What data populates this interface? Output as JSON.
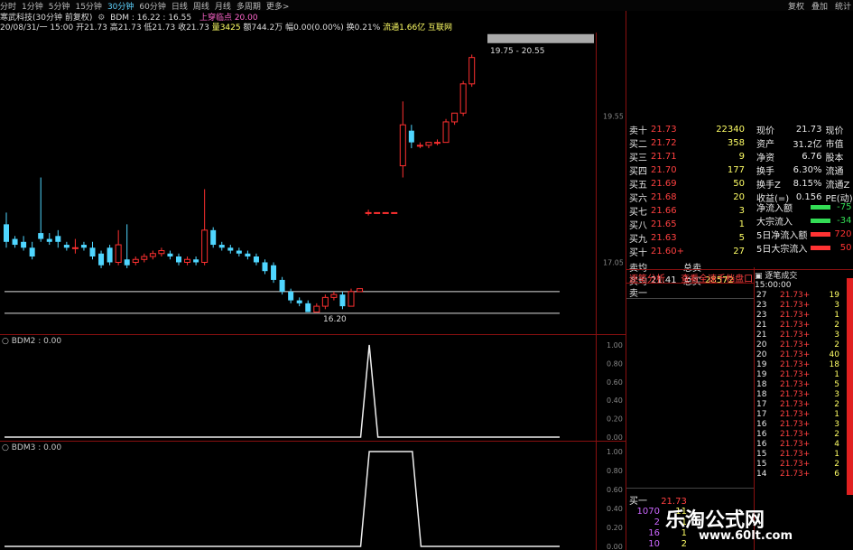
{
  "toolbar": {
    "periods": [
      "分时",
      "1分钟",
      "5分钟",
      "15分钟",
      "30分钟",
      "60分钟",
      "日线",
      "周线",
      "月线",
      "多周期",
      "更多>"
    ],
    "selected": "30分钟",
    "right_buttons": [
      "复权",
      "叠加",
      "统计"
    ]
  },
  "title": {
    "stock": "寒武科技(30分钟 前复权)",
    "indicator": "BDM : 16.22 : 16.55",
    "signal": "上穿临点 20.00"
  },
  "ohlc_line": {
    "date": "20/08/31/一 15:00",
    "open": "开21.73",
    "high": "高21.73",
    "low": "低21.73",
    "close": "收21.73",
    "vol": "量3425",
    "amount": "额744.2万",
    "change": "幅0.00(0.00%)",
    "turnover": "换0.21%",
    "float": "流通1.66亿",
    "link": "互联网"
  },
  "main_chart": {
    "price_axis": [
      "19.55",
      "17.05"
    ],
    "box_label": "19.75 - 20.55",
    "low_label": "16.20",
    "candles": [
      {
        "o": 17.7,
        "c": 17.4,
        "h": 17.9,
        "l": 17.3
      },
      {
        "o": 17.45,
        "c": 17.35,
        "h": 17.5,
        "l": 17.3
      },
      {
        "o": 17.4,
        "c": 17.3,
        "h": 17.5,
        "l": 17.25
      },
      {
        "o": 17.3,
        "c": 17.15,
        "h": 17.4,
        "l": 17.1
      },
      {
        "o": 17.55,
        "c": 17.45,
        "h": 18.5,
        "l": 17.4
      },
      {
        "o": 17.45,
        "c": 17.4,
        "h": 17.55,
        "l": 17.35
      },
      {
        "o": 17.5,
        "c": 17.4,
        "h": 17.6,
        "l": 17.3
      },
      {
        "o": 17.35,
        "c": 17.3,
        "h": 17.4,
        "l": 17.25
      },
      {
        "o": 17.3,
        "c": 17.3,
        "h": 17.45,
        "l": 17.2
      },
      {
        "o": 17.35,
        "c": 17.3,
        "h": 17.4,
        "l": 17.25
      },
      {
        "o": 17.3,
        "c": 17.15,
        "h": 17.4,
        "l": 17.1
      },
      {
        "o": 17.2,
        "c": 17.0,
        "h": 17.25,
        "l": 16.95
      },
      {
        "o": 17.3,
        "c": 17.05,
        "h": 17.35,
        "l": 17.0
      },
      {
        "o": 17.05,
        "c": 17.35,
        "h": 17.6,
        "l": 17.0
      },
      {
        "o": 17.1,
        "c": 17.0,
        "h": 17.7,
        "l": 16.95
      },
      {
        "o": 17.05,
        "c": 17.1,
        "h": 17.15,
        "l": 17.0
      },
      {
        "o": 17.1,
        "c": 17.15,
        "h": 17.2,
        "l": 17.05
      },
      {
        "o": 17.15,
        "c": 17.2,
        "h": 17.25,
        "l": 17.1
      },
      {
        "o": 17.2,
        "c": 17.25,
        "h": 17.3,
        "l": 17.15
      },
      {
        "o": 17.2,
        "c": 17.15,
        "h": 17.25,
        "l": 17.1
      },
      {
        "o": 17.15,
        "c": 17.05,
        "h": 17.2,
        "l": 17.0
      },
      {
        "o": 17.05,
        "c": 17.1,
        "h": 17.15,
        "l": 17.0
      },
      {
        "o": 17.1,
        "c": 17.05,
        "h": 17.15,
        "l": 17.0
      },
      {
        "o": 17.05,
        "c": 17.6,
        "h": 18.3,
        "l": 17.0
      },
      {
        "o": 17.6,
        "c": 17.35,
        "h": 17.65,
        "l": 17.3
      },
      {
        "o": 17.35,
        "c": 17.3,
        "h": 17.4,
        "l": 17.25
      },
      {
        "o": 17.3,
        "c": 17.25,
        "h": 17.35,
        "l": 17.2
      },
      {
        "o": 17.25,
        "c": 17.2,
        "h": 17.3,
        "l": 17.15
      },
      {
        "o": 17.2,
        "c": 17.15,
        "h": 17.25,
        "l": 17.1
      },
      {
        "o": 17.15,
        "c": 17.05,
        "h": 17.2,
        "l": 17.0
      },
      {
        "o": 17.05,
        "c": 16.9,
        "h": 17.1,
        "l": 16.85
      },
      {
        "o": 17.0,
        "c": 16.75,
        "h": 17.05,
        "l": 16.7
      },
      {
        "o": 16.75,
        "c": 16.55,
        "h": 16.8,
        "l": 16.5
      },
      {
        "o": 16.55,
        "c": 16.4,
        "h": 16.6,
        "l": 16.35
      },
      {
        "o": 16.4,
        "c": 16.35,
        "h": 16.45,
        "l": 16.3
      },
      {
        "o": 16.35,
        "c": 16.2,
        "h": 16.4,
        "l": 16.2
      },
      {
        "o": 16.2,
        "c": 16.3,
        "h": 16.35,
        "l": 16.2
      },
      {
        "o": 16.3,
        "c": 16.45,
        "h": 16.5,
        "l": 16.25
      },
      {
        "o": 16.45,
        "c": 16.5,
        "h": 16.55,
        "l": 16.4
      },
      {
        "o": 16.5,
        "c": 16.3,
        "h": 16.55,
        "l": 16.25
      },
      {
        "o": 16.3,
        "c": 16.55,
        "h": 16.6,
        "l": 16.3
      },
      {
        "o": 16.55,
        "c": 16.6,
        "h": 16.6,
        "l": 16.55
      },
      {
        "o": 17.9,
        "c": 17.9,
        "h": 17.95,
        "l": 17.85
      },
      {
        "o": 17.9,
        "c": 17.9,
        "h": 17.9,
        "l": 17.9
      },
      {
        "o": 17.9,
        "c": 17.9,
        "h": 17.9,
        "l": 17.9
      },
      {
        "o": 17.9,
        "c": 17.9,
        "h": 17.9,
        "l": 17.9
      },
      {
        "o": 18.7,
        "c": 19.4,
        "h": 19.8,
        "l": 18.5
      },
      {
        "o": 19.3,
        "c": 19.1,
        "h": 19.4,
        "l": 19.0
      },
      {
        "o": 19.05,
        "c": 19.05,
        "h": 19.1,
        "l": 19.0
      },
      {
        "o": 19.05,
        "c": 19.1,
        "h": 19.1,
        "l": 19.0
      },
      {
        "o": 19.1,
        "c": 19.1,
        "h": 19.15,
        "l": 19.05
      },
      {
        "o": 19.1,
        "c": 19.45,
        "h": 19.5,
        "l": 19.1
      },
      {
        "o": 19.45,
        "c": 19.6,
        "h": 19.6,
        "l": 19.4
      },
      {
        "o": 19.6,
        "c": 20.1,
        "h": 20.15,
        "l": 19.55
      },
      {
        "o": 20.1,
        "c": 20.55,
        "h": 20.6,
        "l": 20.05
      }
    ]
  },
  "indicator1": {
    "label": "BDM2 : 0.00",
    "axis": [
      "1.00",
      "0.80",
      "0.60",
      "0.40",
      "0.20",
      "0.00"
    ],
    "pulse": [
      0,
      0,
      0,
      0,
      0,
      0,
      0,
      0,
      0,
      0,
      0,
      0,
      0,
      0,
      0,
      0,
      0,
      0,
      0,
      0,
      0,
      0,
      0,
      0,
      0,
      0,
      0,
      0,
      0,
      0,
      0,
      0,
      0,
      0,
      0,
      0,
      0,
      0,
      0,
      0,
      0,
      0,
      1,
      0,
      0,
      0,
      0,
      0,
      0,
      0,
      0,
      0,
      0,
      0,
      0
    ]
  },
  "indicator2": {
    "label": "BDM3 : 0.00",
    "axis": [
      "1.00",
      "0.80",
      "0.60",
      "0.40",
      "0.20",
      "0.00"
    ],
    "pulse": [
      0,
      0,
      0,
      0,
      0,
      0,
      0,
      0,
      0,
      0,
      0,
      0,
      0,
      0,
      0,
      0,
      0,
      0,
      0,
      0,
      0,
      0,
      0,
      0,
      0,
      0,
      0,
      0,
      0,
      0,
      0,
      0,
      0,
      0,
      0,
      0,
      0,
      0,
      0,
      0,
      0,
      0,
      1,
      1,
      1,
      1,
      1,
      1,
      0,
      0,
      0,
      0,
      0,
      0,
      0
    ]
  },
  "order_book": {
    "rows": [
      {
        "label": "卖十",
        "price": "21.73",
        "vol": "22340"
      },
      {
        "label": "买二",
        "price": "21.72",
        "vol": "358"
      },
      {
        "label": "买三",
        "price": "21.71",
        "vol": "9"
      },
      {
        "label": "买四",
        "price": "21.70",
        "vol": "177"
      },
      {
        "label": "买五",
        "price": "21.69",
        "vol": "50"
      },
      {
        "label": "买六",
        "price": "21.68",
        "vol": "20"
      },
      {
        "label": "买七",
        "price": "21.66",
        "vol": "3"
      },
      {
        "label": "买八",
        "price": "21.65",
        "vol": "1"
      },
      {
        "label": "买九",
        "price": "21.63",
        "vol": "5"
      },
      {
        "label": "买十",
        "price": "21.60+",
        "vol": "27"
      }
    ],
    "sell_avg": "卖均",
    "buy_avg": "买均",
    "buy_avg_price": "21.41",
    "total_sell": "总卖",
    "total_buy": "总买",
    "total_buy_val": "28572"
  },
  "fundamentals": [
    {
      "label": "现价",
      "val": "21.73",
      "label2": "现价"
    },
    {
      "label": "资产",
      "val": "31.2亿",
      "label2": "市值"
    },
    {
      "label": "净资",
      "val": "6.76",
      "label2": "股本"
    },
    {
      "label": "换手",
      "val": "6.30%",
      "label2": "流通"
    },
    {
      "label": "换手Z",
      "val": "8.15%",
      "label2": "流通Z"
    },
    {
      "label": "收益(=)",
      "val": "0.156",
      "label2": "PE(动)"
    }
  ],
  "flows": [
    {
      "label": "净流入额",
      "val": "-75",
      "color": "#33dd55"
    },
    {
      "label": "大宗流入",
      "val": "-34",
      "color": "#33dd55"
    },
    {
      "label": "5日净流入额",
      "val": "720",
      "color": "#ff3333"
    },
    {
      "label": "5日大宗流入",
      "val": "50",
      "color": "#ff3333"
    }
  ],
  "bottom_tabs": {
    "analysis": "逐笔分析",
    "thousand": "查看全速千档盘口",
    "sell1": "卖一",
    "buy1": "买一",
    "buy1_price": "21.73"
  },
  "trade_panel": {
    "title": "逐笔成交",
    "time": "15:00:00",
    "rows": [
      {
        "p": "21.73+",
        "v": "19"
      },
      {
        "p": "21.73+",
        "v": "3"
      },
      {
        "p": "21.73+",
        "v": "1"
      },
      {
        "p": "21.73+",
        "v": "2"
      },
      {
        "p": "21.73+",
        "v": "3"
      },
      {
        "p": "21.73+",
        "v": "2"
      },
      {
        "p": "21.73+",
        "v": "40"
      },
      {
        "p": "21.73+",
        "v": "18"
      },
      {
        "p": "21.73+",
        "v": "1"
      },
      {
        "p": "21.73+",
        "v": "5"
      },
      {
        "p": "21.73+",
        "v": "3"
      },
      {
        "p": "21.73+",
        "v": "2"
      },
      {
        "p": "21.73+",
        "v": "1"
      },
      {
        "p": "21.73+",
        "v": "3"
      },
      {
        "p": "21.73+",
        "v": "2"
      },
      {
        "p": "21.73+",
        "v": "4"
      },
      {
        "p": "21.73+",
        "v": "1"
      },
      {
        "p": "21.73+",
        "v": "2"
      },
      {
        "p": "21.73+",
        "v": "6"
      }
    ],
    "left_nums": [
      "27",
      "23",
      "23",
      "21",
      "21",
      "20",
      "20",
      "19",
      "19",
      "18",
      "18",
      "17",
      "17",
      "16",
      "16",
      "16",
      "15",
      "15",
      "14"
    ]
  },
  "buy_queue": [
    {
      "a": "1070",
      "b": "11"
    },
    {
      "a": "2",
      "b": "1"
    },
    {
      "a": "16",
      "b": "1"
    },
    {
      "a": "10",
      "b": "2"
    }
  ],
  "watermark": {
    "cn": "乐淘公式网",
    "url": "www.60lt.com"
  }
}
